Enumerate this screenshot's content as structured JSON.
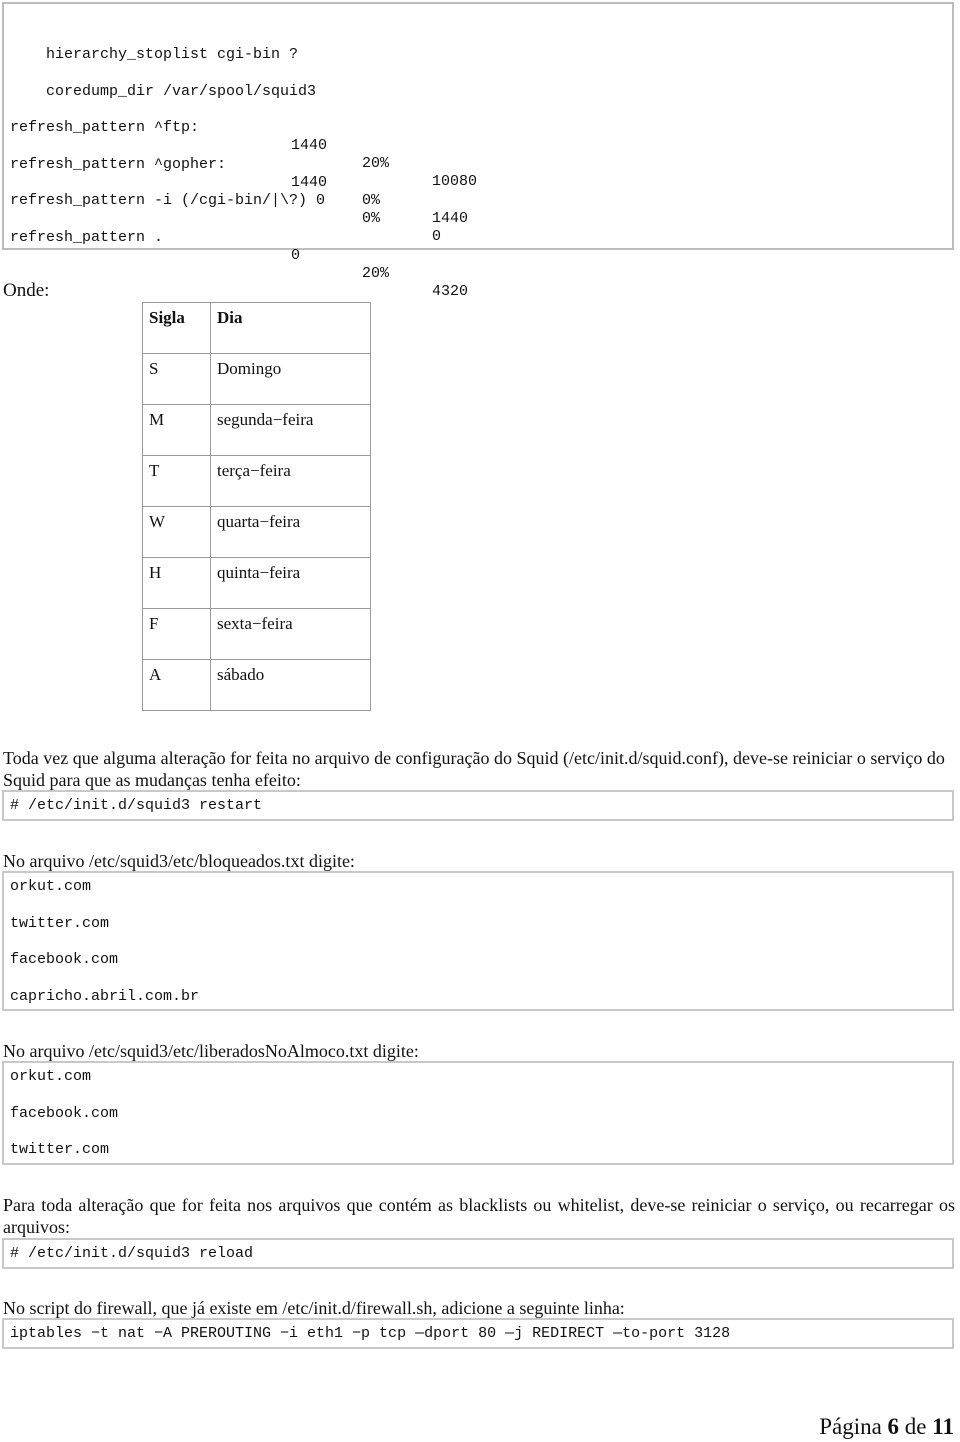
{
  "config_block": {
    "lines": [
      {
        "cols": [
          "hierarchy_stoplist cgi-bin ?"
        ]
      },
      {
        "cols": [
          "coredump_dir /var/spool/squid3"
        ]
      },
      {
        "cols": [
          "refresh_pattern ^ftp:",
          "1440",
          "20%",
          "10080"
        ]
      },
      {
        "cols": [
          "refresh_pattern ^gopher:",
          "1440",
          "0%",
          "1440"
        ]
      },
      {
        "cols": [
          "refresh_pattern -i (/cgi-bin/|\\?) 0",
          "",
          "0%",
          "0"
        ]
      },
      {
        "cols": [
          "refresh_pattern .",
          "0",
          "20%",
          "4320"
        ]
      }
    ]
  },
  "onde_label": "Onde:",
  "days_table": {
    "headers": [
      "Sigla",
      "Dia"
    ],
    "rows": [
      [
        "S",
        "Domingo"
      ],
      [
        "M",
        "segunda−feira"
      ],
      [
        "T",
        "terça−feira"
      ],
      [
        "W",
        "quarta−feira"
      ],
      [
        "H",
        "quinta−feira"
      ],
      [
        "F",
        "sexta−feira"
      ],
      [
        "A",
        "sábado"
      ]
    ]
  },
  "para_restart": "Toda vez que alguma alteração for feita no arquivo de configuração do Squid (/etc/init.d/squid.conf), deve-se reiniciar o serviço do Squid para que as mudanças tenha efeito:",
  "cmd_restart": "# /etc/init.d/squid3 restart",
  "para_bloqueados": "No arquivo /etc/squid3/etc/bloqueados.txt digite:",
  "bloqueados": [
    "orkut.com",
    "twitter.com",
    "facebook.com",
    "capricho.abril.com.br"
  ],
  "para_liberados": "No arquivo /etc/squid3/etc/liberadosNoAlmoco.txt digite:",
  "liberados": [
    "orkut.com",
    "facebook.com",
    "twitter.com"
  ],
  "para_reload": "Para toda alteração que for feita nos arquivos que contém as blacklists ou whitelist, deve-se reiniciar o serviço, ou recarregar os arquivos:",
  "cmd_reload": "# /etc/init.d/squid3 reload",
  "para_firewall": "No script do firewall, que já existe em /etc/init.d/firewall.sh, adicione a seguinte linha:",
  "cmd_iptables": "iptables −t nat −A PREROUTING −i eth1 −p tcp —dport 80 —j REDIRECT —to-port 3128",
  "footer": {
    "page_word": "Página",
    "page_current": "6",
    "of_word": "de",
    "page_total": "11"
  }
}
